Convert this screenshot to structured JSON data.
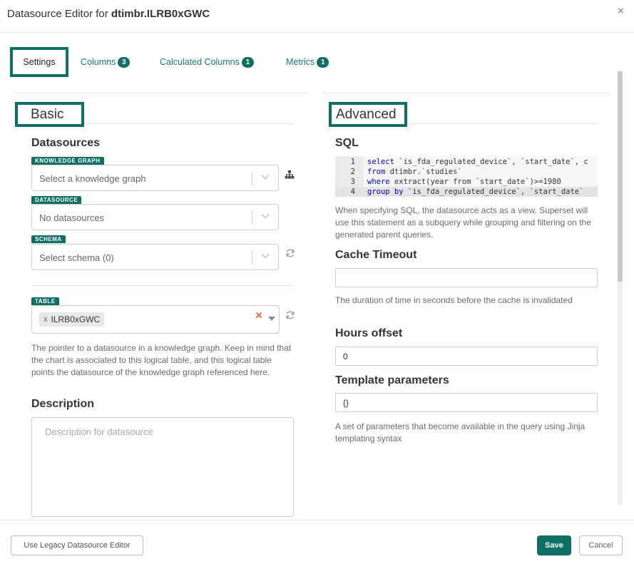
{
  "header": {
    "title_prefix": "Datasource Editor for ",
    "title_name": "dtimbr.ILRB0xGWC",
    "close": "×"
  },
  "tabs": [
    {
      "label": "Settings",
      "active": true
    },
    {
      "label": "Columns",
      "count": "3"
    },
    {
      "label": "Calculated Columns",
      "count": "1"
    },
    {
      "label": "Metrics",
      "count": "1"
    }
  ],
  "basic": {
    "title": "Basic",
    "datasources_heading": "Datasources",
    "knowledge_graph": {
      "tag": "KNOWLEDGE GRAPH",
      "placeholder": "Select a knowledge graph",
      "icon": "sitemap-icon"
    },
    "datasource": {
      "tag": "DATASOURCE",
      "placeholder": "No datasources"
    },
    "schema": {
      "tag": "SCHEMA",
      "placeholder": "Select schema (0)",
      "icon": "refresh-icon"
    },
    "table": {
      "tag": "TABLE",
      "chip_x": "x",
      "value": "ILRB0xGWC",
      "icon": "refresh-icon"
    },
    "help": "The pointer to a datasource in a knowledge graph. Keep in mind that the chart is associated to this logical table, and this logical table points the datasource of the knowledge graph referenced here.",
    "description_heading": "Description",
    "description_placeholder": "Description for datasource"
  },
  "advanced": {
    "title": "Advanced",
    "sql_heading": "SQL",
    "sql_lines": [
      {
        "num": "1",
        "kw": "select",
        "rest": " `is_fda_regulated_device`, `start_date`, c"
      },
      {
        "num": "2",
        "kw": "from",
        "rest": "  dtimbr.`studies`"
      },
      {
        "num": "3",
        "kw": "where",
        "rest": " extract(year from `start_date`)>=1980"
      },
      {
        "num": "4",
        "kw": "group by",
        "rest": " `is_fda_regulated_device`, `start_date`"
      }
    ],
    "sql_help": "When specifying SQL, the datasource acts as a view. Superset will use this statement as a subquery while grouping and filtering on the generated parent queries.",
    "cache_heading": "Cache Timeout",
    "cache_value": "",
    "cache_help": "The duration of time in seconds before the cache is invalidated",
    "hours_heading": "Hours offset",
    "hours_value": "0",
    "template_heading": "Template parameters",
    "template_value": "{}",
    "template_help": "A set of parameters that become available in the query using Jinja templating syntax"
  },
  "footer": {
    "legacy_label": "Use Legacy Datasource Editor",
    "save_label": "Save",
    "cancel_label": "Cancel"
  },
  "colors": {
    "accent": "#0f6f66",
    "clear": "#e8704a"
  }
}
